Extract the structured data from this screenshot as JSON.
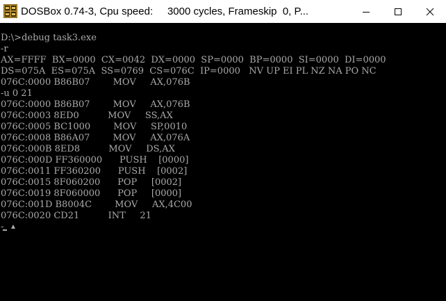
{
  "window": {
    "title": "DOSBox 0.74-3, Cpu speed:     3000 cycles, Frameskip  0, P...",
    "icon": "dosbox-box-icon"
  },
  "screen": {
    "lines": [
      "D:\\>debug task3.exe",
      "-r",
      "AX=FFFF  BX=0000  CX=0042  DX=0000  SP=0000  BP=0000  SI=0000  DI=0000",
      "DS=075A  ES=075A  SS=0769  CS=076C  IP=0000   NV UP EI PL NZ NA PO NC",
      "076C:0000 B86B07        MOV     AX,076B",
      "-u 0 21",
      "076C:0000 B86B07        MOV     AX,076B",
      "076C:0003 8ED0          MOV     SS,AX",
      "076C:0005 BC1000        MOV     SP,0010",
      "076C:0008 B86A07        MOV     AX,076A",
      "076C:000B 8ED8          MOV     DS,AX",
      "076C:000D FF360000      PUSH    [0000]",
      "076C:0011 FF360200      PUSH    [0002]",
      "076C:0015 8F060200      POP     [0002]",
      "076C:0019 8F060000      POP     [0000]",
      "076C:001D B8004C        MOV     AX,4C00",
      "076C:0020 CD21          INT     21",
      "-"
    ]
  },
  "colors": {
    "screen_bg": "#000000",
    "screen_text": "#aaaaaa",
    "titlebar_bg": "#ffffff"
  }
}
